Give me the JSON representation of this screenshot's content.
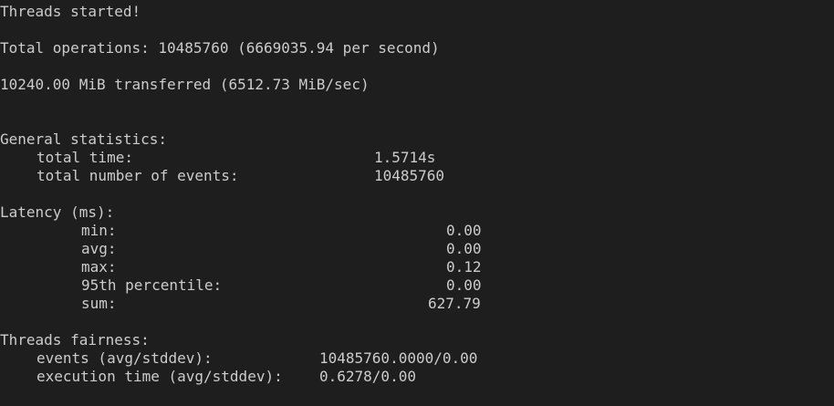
{
  "terminal": {
    "output": {
      "threads_started": "Threads started!",
      "total_operations": "Total operations: 10485760 (6669035.94 per second)",
      "transferred": "10240.00 MiB transferred (6512.73 MiB/sec)",
      "general_header": "General statistics:",
      "total_time_label": "total time:",
      "total_time_value": "1.5714s",
      "total_events_label": "total number of events:",
      "total_events_value": "10485760",
      "latency_header": "Latency (ms):",
      "min_label": "min:",
      "min_value": "0.00",
      "avg_label": "avg:",
      "avg_value": "0.00",
      "max_label": "max:",
      "max_value": "0.12",
      "p95_label": "95th percentile:",
      "p95_value": "0.00",
      "sum_label": "sum:",
      "sum_value": "627.79",
      "fairness_header": "Threads fairness:",
      "events_label": "events (avg/stddev):",
      "events_value": "10485760.0000/0.00",
      "exec_label": "execution time (avg/stddev):",
      "exec_value": "0.6278/0.00"
    }
  },
  "colors": {
    "background": "#1e1e1e",
    "text": "#cccccc"
  }
}
